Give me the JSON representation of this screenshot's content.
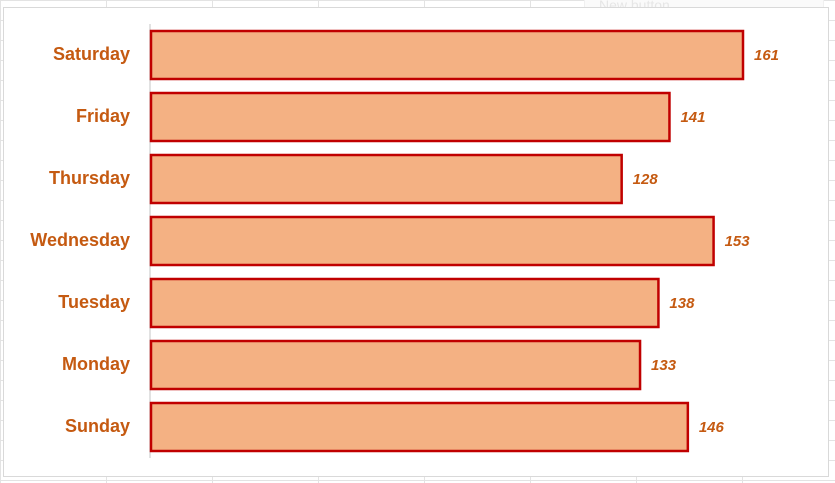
{
  "overlay": {
    "button_label": "New button."
  },
  "chart_data": {
    "type": "bar",
    "orientation": "horizontal",
    "categories": [
      "Saturday",
      "Friday",
      "Thursday",
      "Wednesday",
      "Tuesday",
      "Monday",
      "Sunday"
    ],
    "values": [
      161,
      141,
      128,
      153,
      138,
      133,
      146
    ],
    "title": "",
    "xlabel": "",
    "ylabel": "",
    "xlim": [
      0,
      175
    ],
    "grid": false,
    "legend": "none",
    "data_labels": true,
    "colors": {
      "bar_fill": "#f4b183",
      "bar_border": "#c00000",
      "category_text": "#c55a11",
      "value_text": "#c55a11",
      "axis_line": "#d9d9d9"
    }
  }
}
